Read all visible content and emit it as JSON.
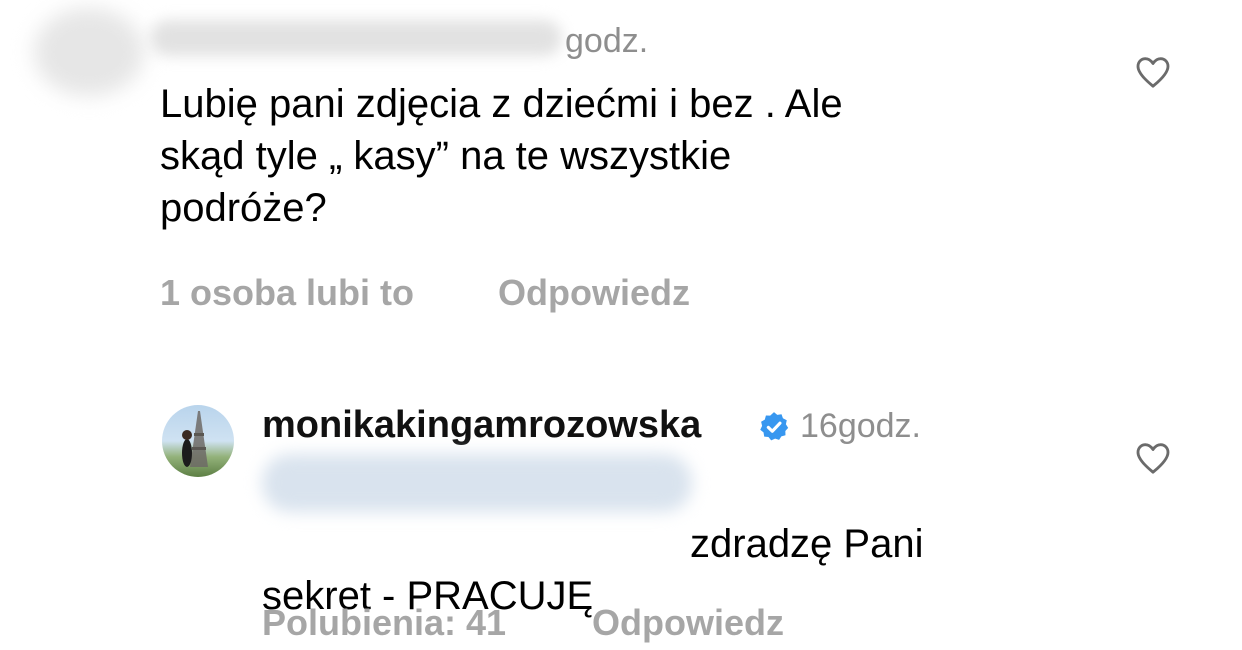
{
  "comment1": {
    "time": "godz.",
    "text": "Lubię pani zdjęcia z dziećmi i bez .  Ale\nskąd tyle „ kasy” na te wszystkie\npodróże?",
    "likes": "1 osoba lubi to",
    "reply": "Odpowiedz"
  },
  "comment2": {
    "username": "monikakingamrozowska",
    "time": "16godz.",
    "text": "zdradzę Pani\nsekret - PRACUJĘ",
    "likes": "Polubienia: 41",
    "reply": "Odpowiedz"
  },
  "icons": {
    "like": "heart-icon",
    "verified": "verified-badge-icon"
  },
  "colors": {
    "text": "#000000",
    "muted": "#8e8e8e",
    "action": "#a6a6a6",
    "verified": "#3797f0"
  }
}
